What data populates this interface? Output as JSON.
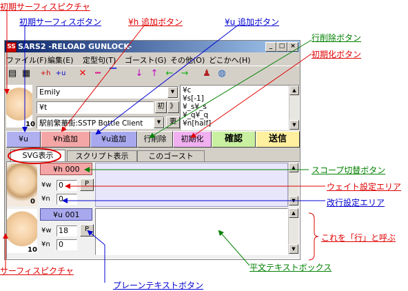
{
  "window": {
    "title": "SARS2 -RELOAD GUNLOCK-",
    "app_icon_text": "SS",
    "min": "_",
    "max": "□",
    "close": "×"
  },
  "menu": [
    "ファイル(F)",
    "編集(E)",
    "定型句(T)",
    "ゴースト(G)",
    "その他(O)",
    "どこかへ(H)"
  ],
  "toolbar": {
    "icons": [
      "save-icon",
      "save-all-icon",
      "add-h-icon",
      "add-u-icon",
      "delete-icon",
      "minus-icon",
      "overline-icon",
      "down-arrow-icon",
      "up-arrow-icon",
      "left-arrow-icon",
      "right-arrow-icon",
      "person-icon",
      "globe-icon"
    ],
    "h_glyph": "+h",
    "u_glyph": "+u"
  },
  "ghost_select": {
    "value": "Emily"
  },
  "text_input": {
    "value": "¥t",
    "init_label": "初",
    "more_label": "》"
  },
  "surface_number": "10",
  "server_select": {
    "value": "駅前繁華街:SSTP Bottle Client",
    "update_label": "更"
  },
  "script_lines": [
    "¥c",
    "¥s[-1]",
    "¥_s¥_s",
    "¥_q¥_q",
    "¥n[half]"
  ],
  "buttons": {
    "u": "¥u",
    "h_add": "¥h追加",
    "u_add": "¥u追加",
    "row_delete": "行削除",
    "init": "初期化",
    "confirm": "確認",
    "send": "送信"
  },
  "tabs": [
    "SVG表示",
    "スクリプト表示",
    "このゴースト"
  ],
  "rows": [
    {
      "scope": "¥h 000",
      "w_label": "¥w",
      "w_value": "0",
      "p_label": "P",
      "n_label": "¥n",
      "n_value": "0",
      "surface": "0"
    },
    {
      "scope": "¥u 001",
      "w_label": "¥w",
      "w_value": "18",
      "p_label": "P",
      "n_label": "¥n",
      "n_value": "0",
      "surface": "10"
    }
  ],
  "annotations": {
    "initial_surface_picture": "初期サーフィスピクチャ",
    "initial_surface_button": "初期サーフィスボタン",
    "h_add_button": "¥h 追加ボタン",
    "u_add_button": "¥u 追加ボタン",
    "row_delete_button": "行削除ボタン",
    "init_button": "初期化ボタン",
    "scope_toggle_button": "スコープ切替ボタン",
    "wait_setting_area": "ウェイト設定エリア",
    "newline_setting_area": "改行設定エリア",
    "row_note": "これを「行」と呼ぶ",
    "plain_text_box": "平文テキストボックス",
    "surface_picture": "サーフィスピクチャ",
    "plain_text_button": "プレーンテキストボタン"
  },
  "colors": {
    "red_label": "#e00000",
    "blue_label": "#0000d0",
    "green_label": "#008000",
    "scope_h": "#f4a6a6",
    "scope_u": "#a8a8ee",
    "confirm": "#c8f0a0",
    "send": "#fff0a0",
    "title_start": "#0a246a",
    "title_end": "#a6caf0"
  }
}
